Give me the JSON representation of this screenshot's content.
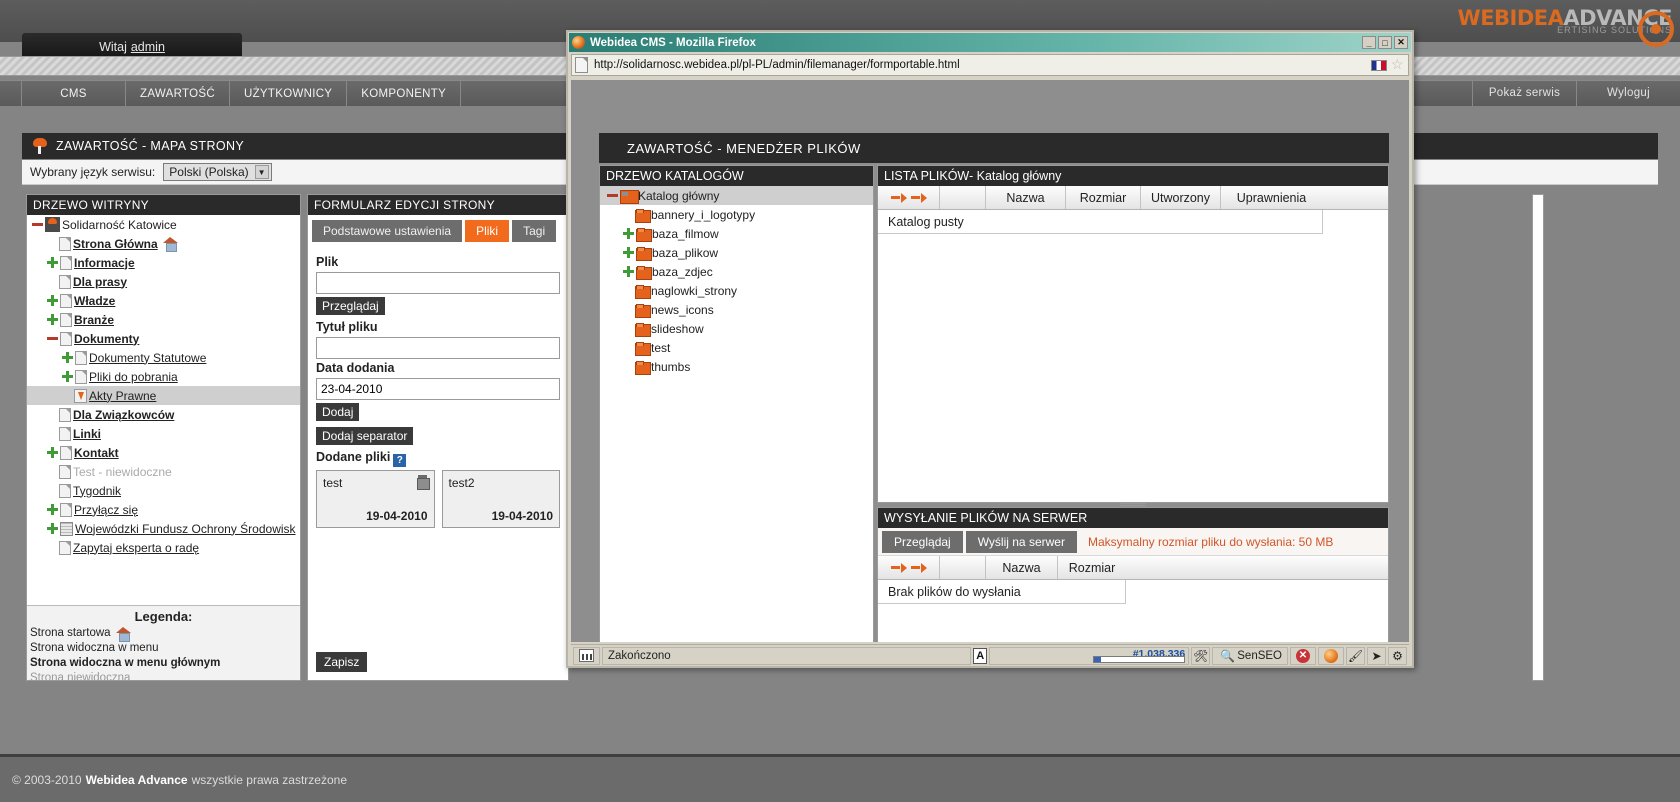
{
  "cms": {
    "welcome": "Witaj",
    "welcome_user": "admin",
    "brand": {
      "line1": "WEBIDEA",
      "line2": "ADVANCE",
      "tagline": "ERTISING SOLUTIONS"
    },
    "menu": [
      "CMS",
      "ZAWARTOŚĆ",
      "UŻYTKOWNICY",
      "KOMPONENTY"
    ],
    "menu_right": [
      "Pokaż serwis",
      "Wyloguj"
    ],
    "page_title": "ZAWARTOŚĆ - MAPA STRONY",
    "language_label": "Wybrany język serwisu:",
    "language_value": "Polski (Polska)",
    "site_tree": {
      "header": "DRZEWO WITRYNY",
      "nodes": [
        {
          "label": "Solidarność Katowice",
          "toggle": "minus",
          "icon": "root-icon",
          "indent": 0,
          "style": "plain"
        },
        {
          "label": "Strona Główna",
          "toggle": "none",
          "icon": "doc-icon",
          "indent": 1,
          "style": "bold",
          "badge": "home-icon"
        },
        {
          "label": "Informacje",
          "toggle": "plus",
          "icon": "doc-icon",
          "indent": 1,
          "style": "bold"
        },
        {
          "label": "Dla prasy",
          "toggle": "none",
          "icon": "doc-icon",
          "indent": 1,
          "style": "bold"
        },
        {
          "label": "Władze",
          "toggle": "plus",
          "icon": "doc-icon",
          "indent": 1,
          "style": "bold"
        },
        {
          "label": "Branże",
          "toggle": "plus",
          "icon": "doc-icon",
          "indent": 1,
          "style": "bold"
        },
        {
          "label": "Dokumenty",
          "toggle": "minus",
          "icon": "doc-icon",
          "indent": 1,
          "style": "bold"
        },
        {
          "label": "Dokumenty Statutowe",
          "toggle": "plus",
          "icon": "doc-icon",
          "indent": 2,
          "style": "normal"
        },
        {
          "label": "Pliki do pobrania",
          "toggle": "plus",
          "icon": "doc-icon",
          "indent": 2,
          "style": "normal"
        },
        {
          "label": "Akty Prawne",
          "toggle": "none",
          "icon": "download-icon",
          "indent": 2,
          "style": "normal",
          "selected": true
        },
        {
          "label": "Dla Związkowców",
          "toggle": "none",
          "icon": "doc-icon",
          "indent": 1,
          "style": "bold"
        },
        {
          "label": "Linki",
          "toggle": "none",
          "icon": "doc-icon",
          "indent": 1,
          "style": "bold"
        },
        {
          "label": "Kontakt",
          "toggle": "plus",
          "icon": "doc-icon",
          "indent": 1,
          "style": "bold"
        },
        {
          "label": "Test - niewidoczne",
          "toggle": "none",
          "icon": "doc-icon",
          "indent": 1,
          "style": "dim"
        },
        {
          "label": "Tygodnik",
          "toggle": "none",
          "icon": "doc-icon",
          "indent": 1,
          "style": "normal"
        },
        {
          "label": "Przyłącz się",
          "toggle": "plus",
          "icon": "doc-icon",
          "indent": 1,
          "style": "normal"
        },
        {
          "label": "Wojewódzki Fundusz Ochrony Środowisk",
          "toggle": "plus",
          "icon": "grid-icon",
          "indent": 1,
          "style": "normal"
        },
        {
          "label": "Zapytaj eksperta o radę",
          "toggle": "none",
          "icon": "doc-icon",
          "indent": 1,
          "style": "normal"
        }
      ],
      "legend": {
        "title": "Legenda:",
        "items": [
          {
            "text": "Strona startowa",
            "style": "normal",
            "badge": "home-icon"
          },
          {
            "text": "Strona widoczna w menu",
            "style": "normal"
          },
          {
            "text": "Strona widoczna w menu głównym",
            "style": "bold"
          },
          {
            "text": "Strona niewidoczna",
            "style": "dim"
          }
        ]
      }
    },
    "form": {
      "header": "FORMULARZ EDYCJI STRONY",
      "tabs": [
        {
          "label": "Podstawowe ustawienia",
          "active": false
        },
        {
          "label": "Pliki",
          "active": true
        },
        {
          "label": "Tagi",
          "active": false
        }
      ],
      "file_label": "Plik",
      "file_value": "",
      "browse_button": "Przeglądaj",
      "title_label": "Tytuł pliku",
      "title_value": "",
      "date_label": "Data dodania",
      "date_value": "23-04-2010",
      "add_button": "Dodaj",
      "add_separator_button": "Dodaj separator",
      "added_files_label": "Dodane pliki",
      "help_badge": "?",
      "added_files": [
        {
          "name": "test",
          "date": "19-04-2010"
        },
        {
          "name": "test2",
          "date": "19-04-2010"
        }
      ],
      "save_button": "Zapisz"
    },
    "footer": {
      "copyright": "© 2003-2010",
      "brand": "Webidea Advance",
      "rights": "wszystkie prawa zastrzeżone"
    }
  },
  "firefox": {
    "window_title": "Webidea CMS - Mozilla Firefox",
    "min_button": "_",
    "max_button": "□",
    "close_button": "✕",
    "url": "http://solidarnosc.webidea.pl/pl-PL/admin/filemanager/formportable.html",
    "page": {
      "title": "ZAWARTOŚĆ - MENEDŻER PLIKÓW",
      "dir_tree": {
        "header": "DRZEWO KATALOGÓW",
        "nodes": [
          {
            "label": "Katalog główny",
            "toggle": "minus",
            "icon": "root-folder-icon",
            "indent": 0,
            "selected": true
          },
          {
            "label": "bannery_i_logotypy",
            "toggle": "none",
            "icon": "folder-icon",
            "indent": 1
          },
          {
            "label": "baza_filmow",
            "toggle": "plus",
            "icon": "folder-icon",
            "indent": 1
          },
          {
            "label": "baza_plikow",
            "toggle": "plus",
            "icon": "folder-icon",
            "indent": 1
          },
          {
            "label": "baza_zdjec",
            "toggle": "plus",
            "icon": "folder-icon",
            "indent": 1
          },
          {
            "label": "naglowki_strony",
            "toggle": "none",
            "icon": "folder-icon",
            "indent": 1
          },
          {
            "label": "news_icons",
            "toggle": "none",
            "icon": "folder-icon",
            "indent": 1
          },
          {
            "label": "slideshow",
            "toggle": "none",
            "icon": "folder-icon",
            "indent": 1
          },
          {
            "label": "test",
            "toggle": "none",
            "icon": "folder-icon",
            "indent": 1
          },
          {
            "label": "thumbs",
            "toggle": "none",
            "icon": "folder-icon",
            "indent": 1
          }
        ]
      },
      "file_list": {
        "header": "LISTA PLIKÓW- Katalog główny",
        "columns": [
          "",
          "",
          "Nazwa",
          "Rozmiar",
          "Utworzony",
          "Uprawnienia"
        ],
        "empty_message": "Katalog pusty"
      },
      "upload": {
        "header": "WYSYŁANIE PLIKÓW NA SERWER",
        "browse_button": "Przeglądaj",
        "send_button": "Wyślij na serwer",
        "max_size_info": "Maksymalny rozmiar pliku do wysłania: 50 MB",
        "columns": [
          "",
          "",
          "Nazwa",
          "Rozmiar"
        ],
        "empty_message": "Brak plików do wysłania"
      }
    },
    "status": {
      "text": "Zakończono",
      "rank": "#1,038,336",
      "senseo": "SenSEO"
    }
  }
}
